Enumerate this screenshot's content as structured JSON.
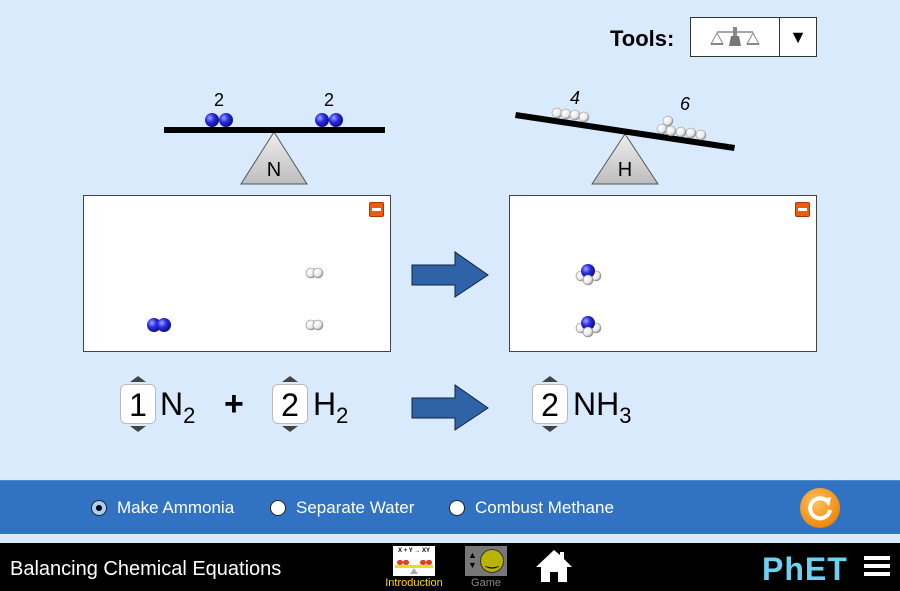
{
  "tools": {
    "label": "Tools:",
    "selected_icon": "balance-scale-icon",
    "dropdown_icon": "triangle-down-icon"
  },
  "balances": [
    {
      "element": "N",
      "left_count": "2",
      "right_count": "2",
      "tilt": "level"
    },
    {
      "element": "H",
      "left_count": "4",
      "right_count": "6",
      "tilt": "right-down"
    }
  ],
  "reactants_box": {
    "molecules": [
      {
        "type": "H2",
        "count": 2
      },
      {
        "type": "N2",
        "count": 1
      }
    ]
  },
  "products_box": {
    "molecules": [
      {
        "type": "NH3",
        "count": 2
      }
    ]
  },
  "equation": {
    "terms": [
      {
        "coefficient": "1",
        "formula": "N",
        "subscript": "2"
      },
      {
        "coefficient": "2",
        "formula": "H",
        "subscript": "2"
      },
      {
        "coefficient": "2",
        "formula": "NH",
        "subscript": "3"
      }
    ],
    "plus": "+"
  },
  "reactions": {
    "options": [
      "Make Ammonia",
      "Separate Water",
      "Combust Methane"
    ],
    "selected": "Make Ammonia"
  },
  "nav": {
    "title": "Balancing Chemical Equations",
    "screens": [
      {
        "label": "Introduction",
        "icon_text": "X + Y → XY",
        "active": true
      },
      {
        "label": "Game",
        "active": false
      }
    ],
    "logo": "PhET"
  },
  "colors": {
    "background": "#d9eafc",
    "panel": "#3173c2",
    "arrow": "#2f63a8",
    "nitrogen": "#2a2ae0",
    "active_screen": "#ffd700"
  }
}
